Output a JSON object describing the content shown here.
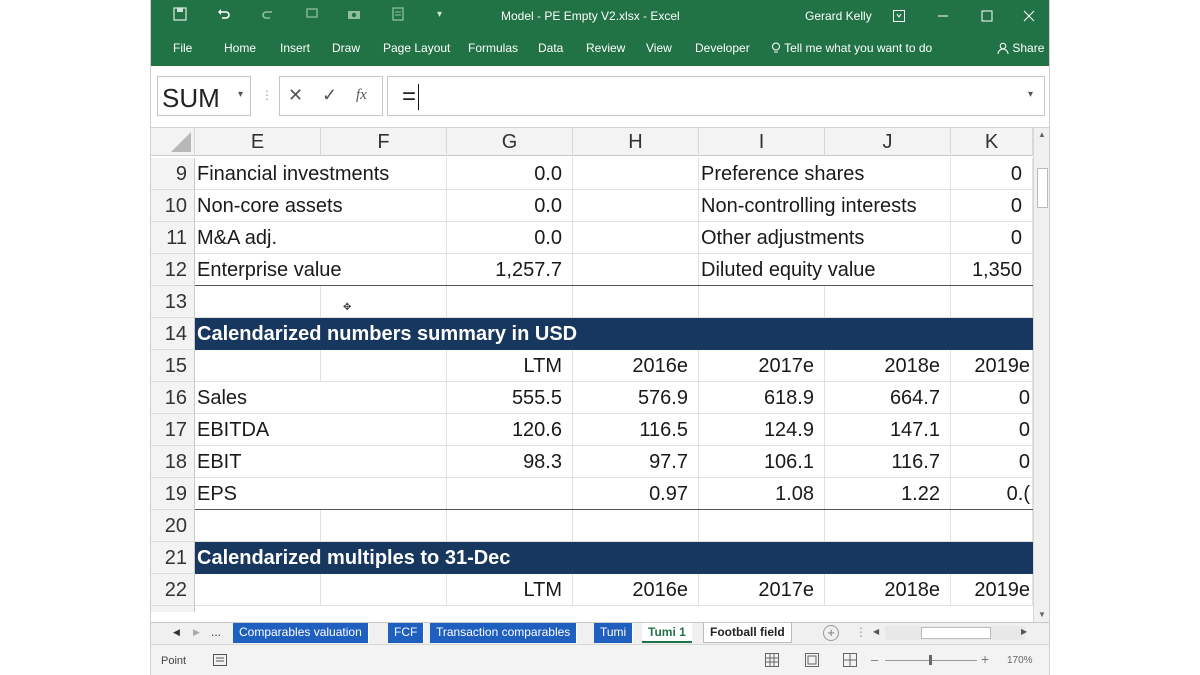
{
  "window": {
    "title": "Model - PE Empty V2.xlsx  -  Excel",
    "user": "Gerard Kelly"
  },
  "ribbon": {
    "tabs": [
      "File",
      "Home",
      "Insert",
      "Draw",
      "Page Layout",
      "Formulas",
      "Data",
      "Review",
      "View",
      "Developer"
    ],
    "tell_me": "Tell me what you want to do",
    "share": "Share"
  },
  "formula_bar": {
    "name_box": "SUM",
    "formula": "="
  },
  "grid": {
    "columns": [
      "E",
      "F",
      "G",
      "H",
      "I",
      "J",
      "K"
    ],
    "rows": [
      {
        "num": "9",
        "label": "Financial investments",
        "g": "0.0",
        "i": "Preference shares",
        "k": "0"
      },
      {
        "num": "10",
        "label": "Non-core assets",
        "g": "0.0",
        "i": "Non-controlling interests",
        "k": "0"
      },
      {
        "num": "11",
        "label": "M&A adj.",
        "g": "0.0",
        "i": "Other adjustments",
        "k": "0"
      },
      {
        "num": "12",
        "label": "Enterprise value",
        "g": "1,257.7",
        "i": "Diluted equity value",
        "k": "1,350"
      },
      {
        "num": "13"
      },
      {
        "num": "14",
        "banner": "Calendarized numbers summary in USD"
      },
      {
        "num": "15",
        "g": "LTM",
        "h": "2016e",
        "i2": "2017e",
        "j": "2018e",
        "k": "2019e"
      },
      {
        "num": "16",
        "label": "Sales",
        "g": "555.5",
        "h": "576.9",
        "i2": "618.9",
        "j": "664.7",
        "k": "0"
      },
      {
        "num": "17",
        "label": "EBITDA",
        "g": "120.6",
        "h": "116.5",
        "i2": "124.9",
        "j": "147.1",
        "k": "0"
      },
      {
        "num": "18",
        "label": "EBIT",
        "g": "98.3",
        "h": "97.7",
        "i2": "106.1",
        "j": "116.7",
        "k": "0"
      },
      {
        "num": "19",
        "label": "EPS",
        "h": "0.97",
        "i2": "1.08",
        "j": "1.22",
        "k": "0.("
      },
      {
        "num": "20"
      },
      {
        "num": "21",
        "banner": "Calendarized multiples to 31-Dec"
      },
      {
        "num": "22",
        "g": "LTM",
        "h": "2016e",
        "i2": "2017e",
        "j": "2018e",
        "k": "2019e"
      }
    ]
  },
  "sheet_tabs": {
    "overflow": "...",
    "tabs": [
      "Comparables valuation",
      "FCF",
      "Transaction comparables",
      "Tumi",
      "Tumi 1",
      "Football field"
    ],
    "active": "Tumi 1"
  },
  "status": {
    "mode": "Point",
    "zoom": "170%"
  }
}
